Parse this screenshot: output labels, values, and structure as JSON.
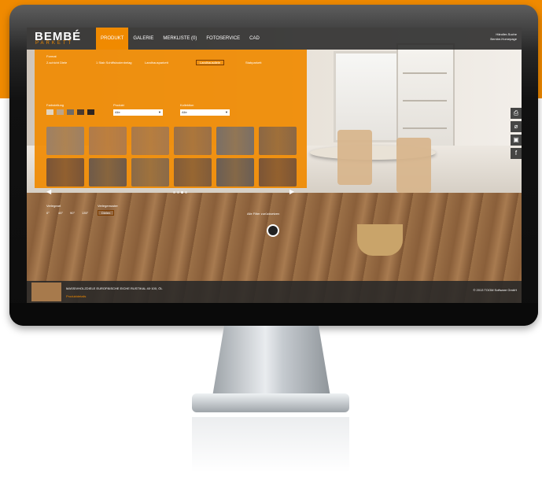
{
  "colors": {
    "accent": "#f08a00",
    "bar": "#282828"
  },
  "logo": {
    "word": "BEMBÉ",
    "sub": "PARKETT"
  },
  "nav": {
    "tabs": [
      "PRODUKT",
      "GALERIE",
      "MERKLISTE (0)",
      "FOTOSERVICE",
      "CAD"
    ],
    "active": "PRODUKT"
  },
  "top_links": [
    "Händler-Suche",
    "Bembe-Homepage"
  ],
  "panel": {
    "format_label": "Format",
    "format_options": [
      "2-schicht Diele",
      "1 Stab Schiffsbodenbelag",
      "Landhausparkett",
      "Landhausdiele",
      "Stabparkett"
    ],
    "format_selected": "Landhausdiele",
    "color_label": "Farbstellung",
    "produkt_label": "Produkt",
    "produkt_value": "Alle",
    "kollektion_label": "Kollektion",
    "kollektion_value": "Alle",
    "tiles": [
      "#9d8064",
      "#b07b4a",
      "#a9794a",
      "#9b7046",
      "#7a6f66",
      "#8b6744",
      "#7a5437",
      "#6e5a49",
      "#8a6a48",
      "#815c3a",
      "#6a5e55",
      "#7c5536"
    ],
    "swatches": [
      "#e2d4bf",
      "#bda487",
      "#6f6a65",
      "#4b3a2e",
      "#2e2520"
    ],
    "pager_dots": 4,
    "pager_active": 2,
    "verlegeart_label": "Verlegeart",
    "verlegeart_values": [
      "0°",
      "45°",
      "90°",
      "135°"
    ],
    "verlegemuster_label": "Verlegemuster",
    "verlegemuster_value": "Dielen",
    "all_filters": "Alle Filter zurücksetzen"
  },
  "tools": [
    "print-icon",
    "tag-icon",
    "save-icon",
    "facebook-icon"
  ],
  "bottom": {
    "title": "MASSIVHOLZDIELE EUROPÄISCHE EICHE RUSTIKAL 40·100, ÖL",
    "link": "Produktdetails",
    "copyright": "© 2013 TOOM Software GmbH"
  }
}
